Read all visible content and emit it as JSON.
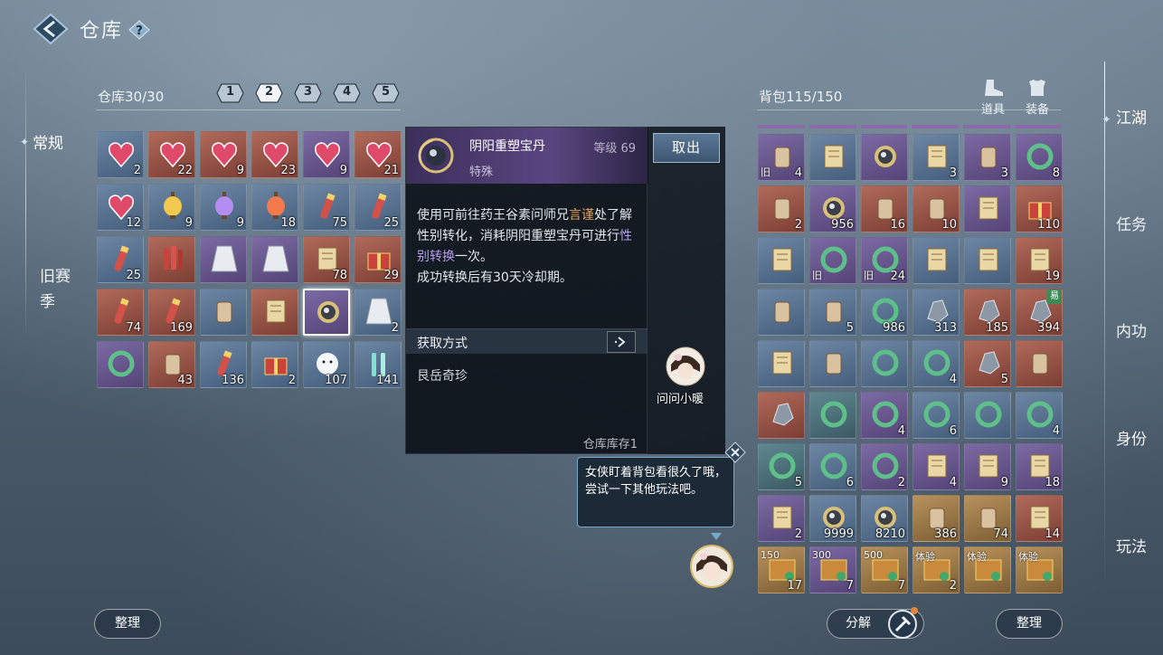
{
  "header": {
    "title": "仓库"
  },
  "left_nav": {
    "active": "常规",
    "season": "旧赛季"
  },
  "right_nav": [
    "江湖",
    "任务",
    "内功",
    "身份",
    "玩法"
  ],
  "warehouse": {
    "label": "仓库",
    "capacity": "30/30",
    "pages": [
      "1",
      "2",
      "3",
      "4",
      "5"
    ],
    "items": [
      {
        "name": "heart-gems",
        "color": "blue",
        "count": "2"
      },
      {
        "name": "red-heart",
        "color": "red",
        "count": "22"
      },
      {
        "name": "red-heart",
        "color": "red",
        "count": "9"
      },
      {
        "name": "red-heart",
        "color": "red",
        "count": "23"
      },
      {
        "name": "red-heart",
        "color": "purple",
        "count": "9"
      },
      {
        "name": "heart-gems",
        "color": "red",
        "count": "21"
      },
      {
        "name": "heart-gems",
        "color": "blue",
        "count": "12"
      },
      {
        "name": "lantern-yellow",
        "color": "blue",
        "count": "9"
      },
      {
        "name": "lantern-purple",
        "color": "blue",
        "count": "9"
      },
      {
        "name": "lantern-red",
        "color": "blue",
        "count": "18"
      },
      {
        "name": "firecracker",
        "color": "blue",
        "count": "75"
      },
      {
        "name": "firecracker",
        "color": "blue",
        "count": "25"
      },
      {
        "name": "firecracker",
        "color": "blue",
        "count": "25"
      },
      {
        "name": "firework-bundle",
        "color": "red",
        "count": ""
      },
      {
        "name": "robe",
        "color": "purple",
        "count": ""
      },
      {
        "name": "robe-ornate",
        "color": "purple",
        "count": ""
      },
      {
        "name": "blue-scroll",
        "color": "red",
        "count": "78"
      },
      {
        "name": "gift-box",
        "color": "red",
        "count": "29"
      },
      {
        "name": "firecracker-string",
        "color": "red",
        "count": "74"
      },
      {
        "name": "scroll-red",
        "color": "red",
        "count": "169"
      },
      {
        "name": "bell-fish",
        "color": "blue",
        "count": ""
      },
      {
        "name": "scroll-map",
        "color": "red",
        "count": ""
      },
      {
        "name": "yin-yang-pill",
        "color": "purple",
        "count": "",
        "selected": true
      },
      {
        "name": "robe-dark",
        "color": "blue",
        "count": "2"
      },
      {
        "name": "medal",
        "color": "purple",
        "count": ""
      },
      {
        "name": "kite",
        "color": "red",
        "count": "43"
      },
      {
        "name": "rocket",
        "color": "blue",
        "count": "136"
      },
      {
        "name": "jade-box",
        "color": "blue",
        "count": "2"
      },
      {
        "name": "ghost-face",
        "color": "blue",
        "count": "107"
      },
      {
        "name": "glow-stick",
        "color": "blue",
        "count": "141"
      }
    ]
  },
  "tooltip": {
    "name": "阴阳重塑宝丹",
    "level": "等级 69",
    "type": "特殊",
    "desc_1": "使用可前往药王谷素问师兄",
    "desc_hl1": "言谨",
    "desc_2": "处了解性别转化，消耗阴阳重塑宝丹可进行",
    "desc_hl2": "性别转换",
    "desc_3": "一次。",
    "desc_4": "成功转换后有30天冷却期。",
    "source_label": "获取方式",
    "source_value": "艮岳奇珍",
    "stock": "仓库库存1",
    "take_out": "取出",
    "ask": "问问小暖"
  },
  "bubble": {
    "text": "女侠盯着背包看很久了哦，尝试一下其他玩法吧。"
  },
  "bag": {
    "label": "背包",
    "capacity": "115/150",
    "tabs": [
      "道具",
      "装备"
    ],
    "items": [
      {
        "name": "sword",
        "color": "purple",
        "count": "4",
        "tag": "旧"
      },
      {
        "name": "scroll",
        "color": "blue",
        "count": ""
      },
      {
        "name": "pink-orb-cart",
        "color": "purple",
        "count": ""
      },
      {
        "name": "scroll",
        "color": "blue",
        "count": "3"
      },
      {
        "name": "brush",
        "color": "purple",
        "count": "3"
      },
      {
        "name": "gold-coin",
        "color": "purple",
        "count": "8"
      },
      {
        "name": "red-envelopes",
        "color": "red",
        "count": "2"
      },
      {
        "name": "pink-orb",
        "color": "purple",
        "count": "956"
      },
      {
        "name": "wood-token",
        "color": "red",
        "count": "16"
      },
      {
        "name": "wood-token",
        "color": "red",
        "count": "10"
      },
      {
        "name": "cards",
        "color": "purple",
        "count": ""
      },
      {
        "name": "chest",
        "color": "red",
        "count": "110"
      },
      {
        "name": "scroll",
        "color": "blue",
        "count": ""
      },
      {
        "name": "badge-red",
        "color": "purple",
        "count": "",
        "tag": "旧"
      },
      {
        "name": "badge-gold",
        "color": "purple",
        "count": "24",
        "tag": "旧"
      },
      {
        "name": "paper-note",
        "color": "blue",
        "count": ""
      },
      {
        "name": "book",
        "color": "blue",
        "count": ""
      },
      {
        "name": "talisman-red",
        "color": "red",
        "count": "19"
      },
      {
        "name": "staff",
        "color": "blue",
        "count": ""
      },
      {
        "name": "bowl",
        "color": "blue",
        "count": "5"
      },
      {
        "name": "gong",
        "color": "blue",
        "count": "986"
      },
      {
        "name": "ore-gray",
        "color": "blue",
        "count": "313"
      },
      {
        "name": "ore-dark",
        "color": "red",
        "count": "185"
      },
      {
        "name": "ore-bound",
        "color": "red",
        "count": "394",
        "badge": "易"
      },
      {
        "name": "ticket",
        "color": "blue",
        "count": ""
      },
      {
        "name": "bundle",
        "color": "blue",
        "count": ""
      },
      {
        "name": "ring-gold",
        "color": "blue",
        "count": ""
      },
      {
        "name": "ring-purple",
        "color": "blue",
        "count": "4"
      },
      {
        "name": "flame-crystal",
        "color": "red",
        "count": "5"
      },
      {
        "name": "bundle",
        "color": "red",
        "count": ""
      },
      {
        "name": "ice-crystal",
        "color": "red",
        "count": ""
      },
      {
        "name": "jade-ring",
        "color": "teal",
        "count": ""
      },
      {
        "name": "jade-ring",
        "color": "purple",
        "count": "4"
      },
      {
        "name": "jade-ring",
        "color": "blue",
        "count": "6"
      },
      {
        "name": "jade-ring-red",
        "color": "blue",
        "count": ""
      },
      {
        "name": "jade-ring-blue",
        "color": "blue",
        "count": "4"
      },
      {
        "name": "jade-ring",
        "color": "teal",
        "count": "5"
      },
      {
        "name": "jade-ring",
        "color": "blue",
        "count": "6"
      },
      {
        "name": "jade-ring-pink",
        "color": "purple",
        "count": "2"
      },
      {
        "name": "tag-gold",
        "color": "purple",
        "count": "4"
      },
      {
        "name": "tag-purple",
        "color": "purple",
        "count": "9"
      },
      {
        "name": "tag-pink",
        "color": "purple",
        "count": "18"
      },
      {
        "name": "scroll-pink",
        "color": "purple",
        "count": "2"
      },
      {
        "name": "eye-orb",
        "color": "blue",
        "count": "9999"
      },
      {
        "name": "eye-orb",
        "color": "blue",
        "count": "8210"
      },
      {
        "name": "gold-bundle",
        "color": "gold",
        "count": "386"
      },
      {
        "name": "gold-bundle",
        "color": "gold",
        "count": "74"
      },
      {
        "name": "red-card",
        "color": "red",
        "count": "14"
      },
      {
        "name": "voucher-150",
        "color": "gold",
        "count": "17",
        "label": "150"
      },
      {
        "name": "voucher-300",
        "color": "purple",
        "count": "7",
        "label": "300"
      },
      {
        "name": "voucher-500",
        "color": "gold",
        "count": "7",
        "label": "500"
      },
      {
        "name": "voucher",
        "color": "gold",
        "count": "2",
        "label": "体验"
      },
      {
        "name": "voucher-dark",
        "color": "gold",
        "count": "",
        "label": "体验"
      },
      {
        "name": "voucher-dark",
        "color": "gold",
        "count": "",
        "label": "体验"
      }
    ]
  },
  "buttons": {
    "sort_left": "整理",
    "decompose": "分解",
    "sort_right": "整理"
  },
  "colors": {
    "blue": "#567393",
    "purple": "#6a5a93",
    "red": "#9a5448",
    "gold": "#a67e4a",
    "highlight_orange": "#e5a45f",
    "highlight_purple": "#b89df0"
  }
}
